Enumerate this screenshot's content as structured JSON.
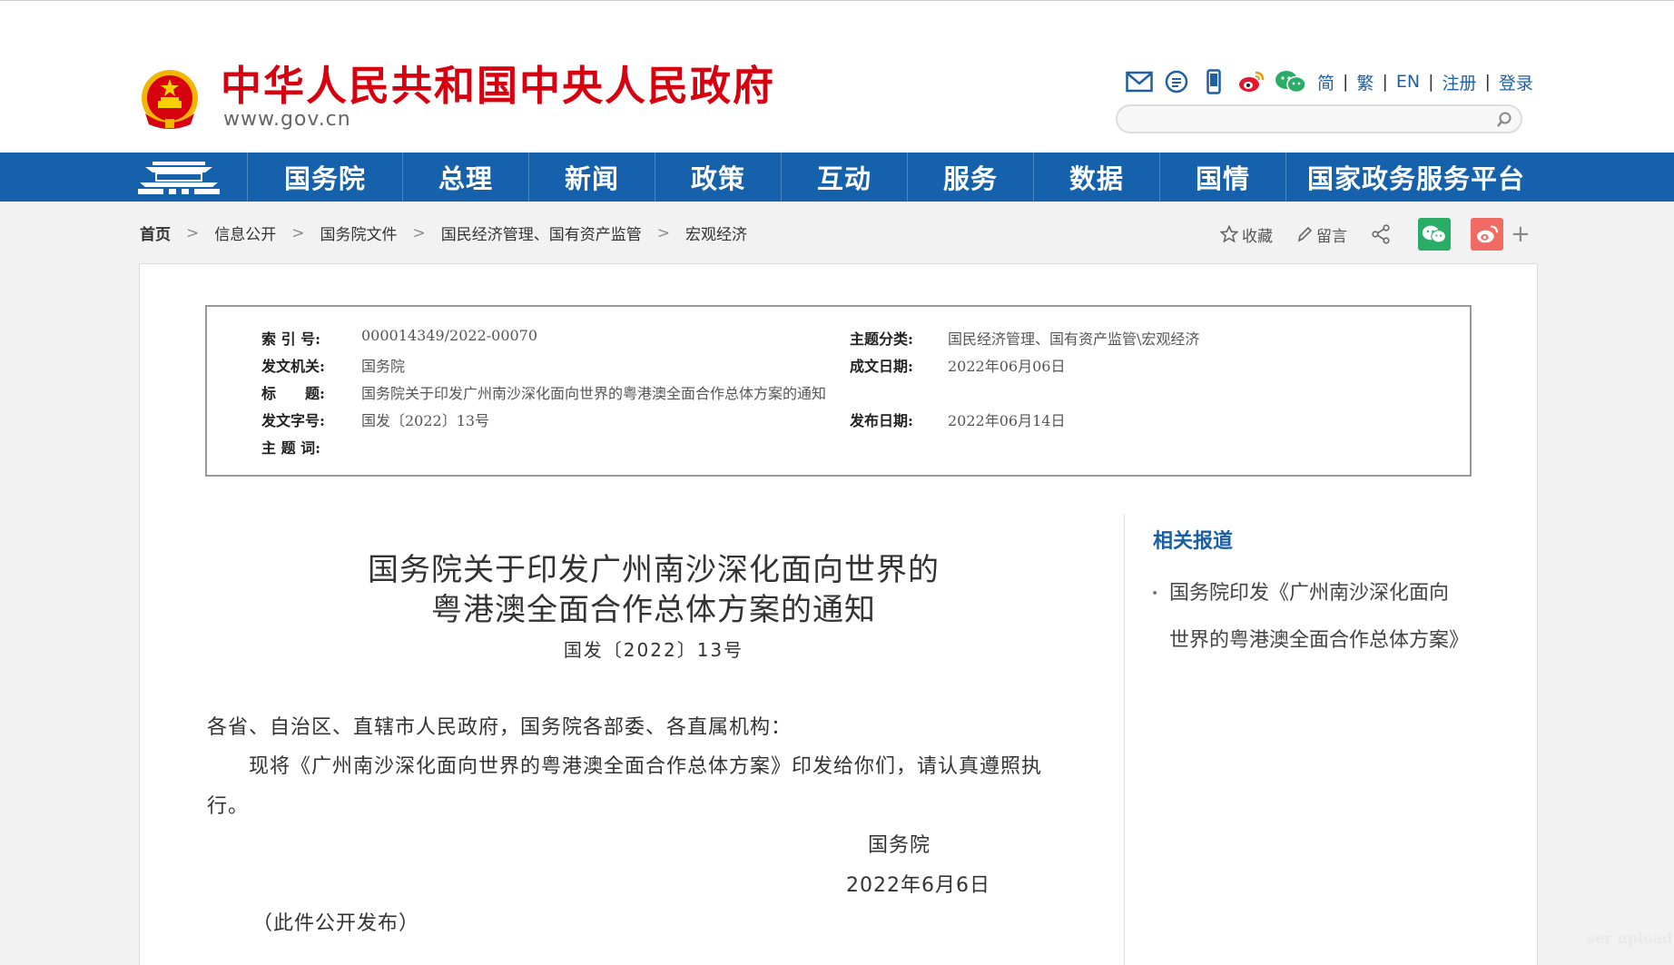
{
  "header": {
    "site_name": "中华人民共和国中央人民政府",
    "site_url": "www.gov.cn",
    "lang_links": [
      "简",
      "繁",
      "EN",
      "注册",
      "登录"
    ],
    "search_placeholder": ""
  },
  "nav": {
    "items": [
      "国务院",
      "总理",
      "新闻",
      "政策",
      "互动",
      "服务",
      "数据",
      "国情",
      "国家政务服务平台"
    ]
  },
  "breadcrumb": [
    "首页",
    "信息公开",
    "国务院文件",
    "国民经济管理、国有资产监管",
    "宏观经济"
  ],
  "tools": {
    "favorite": "收藏",
    "comment": "留言"
  },
  "meta": {
    "index_label": "索 引 号:",
    "index_value": "000014349/2022-00070",
    "category_label": "主题分类:",
    "category_value": "国民经济管理、国有资产监管\\宏观经济",
    "issuer_label": "发文机关:",
    "issuer_value": "国务院",
    "written_date_label": "成文日期:",
    "written_date_value": "2022年06月06日",
    "title_label": "标　　题:",
    "title_value": "国务院关于印发广州南沙深化面向世界的粤港澳全面合作总体方案的通知",
    "doc_no_label": "发文字号:",
    "doc_no_value": "国发〔2022〕13号",
    "publish_date_label": "发布日期:",
    "publish_date_value": "2022年06月14日",
    "keywords_label": "主 题 词:"
  },
  "article": {
    "title_line1": "国务院关于印发广州南沙深化面向世界的",
    "title_line2": "粤港澳全面合作总体方案的通知",
    "doc_number": "国发〔2022〕13号",
    "salutation": "各省、自治区、直辖市人民政府，国务院各部委、各直属机构：",
    "body_line1": "　　现将《广州南沙深化面向世界的粤港澳全面合作总体方案》印发给你们，请认真遵照执",
    "body_line2": "行。",
    "signature": "国务院",
    "date": "2022年6月6日",
    "note": "（此件公开发布）"
  },
  "related": {
    "title": "相关报道",
    "items": [
      "国务院印发《广州南沙深化面向世界的粤港澳全面合作总体方案》"
    ]
  },
  "watermark": "ser upload",
  "colors": {
    "brand_red": "#d7000f",
    "nav_blue": "#1661ab",
    "link_blue": "#1a5fa6",
    "wechat_green": "#2aae67",
    "weibo_red": "#e6162d"
  }
}
